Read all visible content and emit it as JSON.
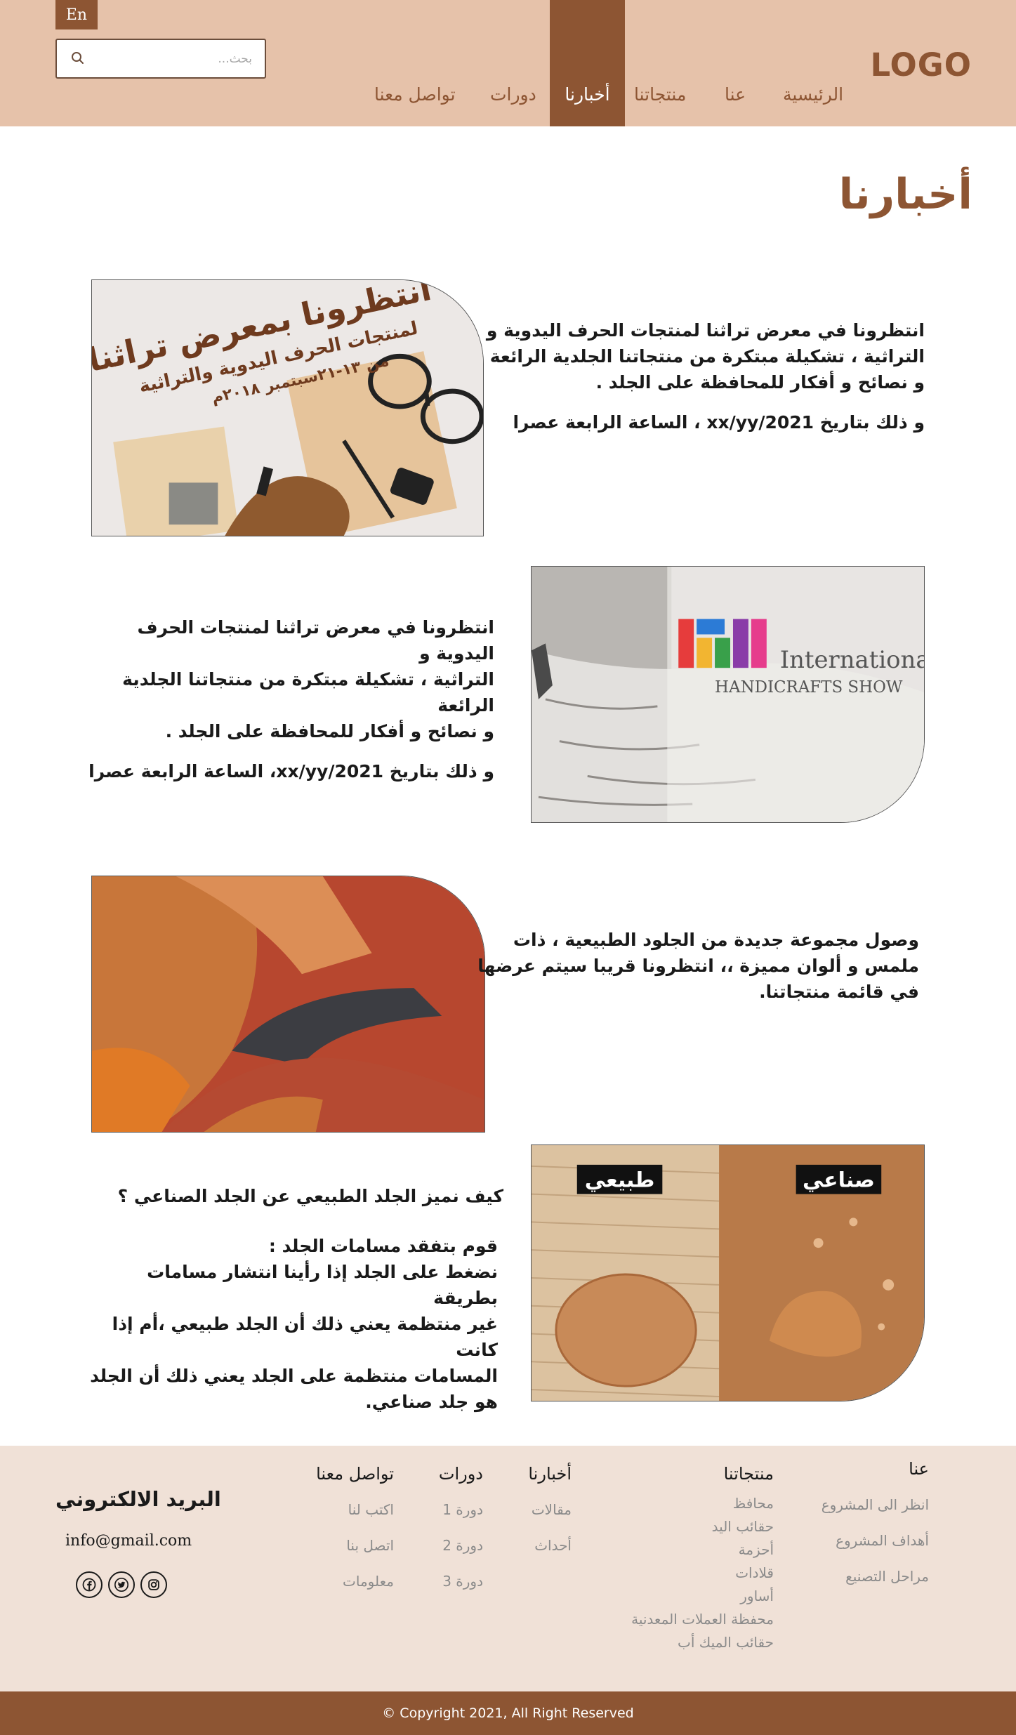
{
  "header": {
    "lang_label": "En",
    "search_placeholder": "بحث...",
    "logo": "LOGO",
    "nav": {
      "home": "الرئيسية",
      "about": "عنا",
      "products": "منتجاتنا",
      "news": "أخبارنا",
      "courses": "دورات",
      "contact": "تواصل معنا"
    },
    "active_nav": "news"
  },
  "page_title": "أخبارنا",
  "articles": [
    {
      "lines": [
        "انتظرونا في معرض تراثنا لمنتجات الحرف اليدوية و",
        "التراثية ، تشكيلة مبتكرة من منتجاتنا الجلدية الرائعة",
        "و نصائح و أفكار للمحافظة على الجلد ."
      ],
      "date_line": "و ذلك بتاريخ xx/yy/2021 ، الساعة الرابعة عصرا",
      "image_title": "انتظرونا بمعرض تراثنا",
      "image_subtitle": "لمنتجات الحرف اليدوية والتراثية",
      "image_dates": "من ١٣-٢١سبتمبر ٢٠١٨م"
    },
    {
      "lines": [
        "انتظرونا في معرض تراثنا لمنتجات الحرف اليدوية و",
        "التراثية ، تشكيلة مبتكرة من منتجاتنا الجلدية الرائعة",
        "و نصائح و أفكار للمحافظة على الجلد ."
      ],
      "date_line": "و ذلك بتاريخ xx/yy/2021، الساعة الرابعة عصرا",
      "image_line1": "International",
      "image_line2": "HANDICRAFTS SHOW"
    },
    {
      "lines": [
        "وصول مجموعة جديدة من الجلود الطبيعية ، ذات",
        "ملمس و ألوان مميزة ،، انتظرونا قريبا سيتم عرضها",
        "في قائمة منتجاتنا."
      ]
    },
    {
      "question": "كيف نميز الجلد الطبيعي عن الجلد الصناعي ؟",
      "lines": [
        "قوم بتفقد مسامات الجلد :",
        "نضغط على الجلد إذا رأينا انتشار مسامات بطريقة",
        "غير منتظمة يعني ذلك أن الجلد طبيعي ،أم إذا كانت",
        "المسامات منتظمة على الجلد يعني ذلك أن الجلد",
        "هو جلد صناعي."
      ],
      "label_natural": "طبيعي",
      "label_synthetic": "صناعي"
    }
  ],
  "footer": {
    "about": {
      "title": "عنا",
      "links": [
        "انظر الى المشروع",
        "أهداف المشروع",
        "مراحل التصنيع"
      ]
    },
    "products": {
      "title": "منتجاتنا",
      "links": [
        "محافظ",
        "حقائب اليد",
        "أحزمة",
        "قلادات",
        "أساور",
        "محفظة العملات المعدنية",
        "حقائب الميك أب"
      ]
    },
    "news": {
      "title": "أخبارنا",
      "links": [
        "مقالات",
        "أحداث"
      ]
    },
    "courses": {
      "title": "دورات",
      "links": [
        "دورة 1",
        "دورة 2",
        "دورة 3"
      ]
    },
    "contact": {
      "title": "تواصل معنا",
      "links": [
        "اكتب لنا",
        "اتصل بنا",
        "معلومات"
      ]
    },
    "email_title": "البريد الالكتروني",
    "email": "info@gmail.com",
    "socials": [
      "facebook-icon",
      "twitter-icon",
      "instagram-icon"
    ]
  },
  "copyright": "© Copyright 2021, All Right Reserved",
  "colors": {
    "brown": "#8d5533",
    "header_bg": "#e6c2aa",
    "footer_bg": "#f0e1d7"
  }
}
